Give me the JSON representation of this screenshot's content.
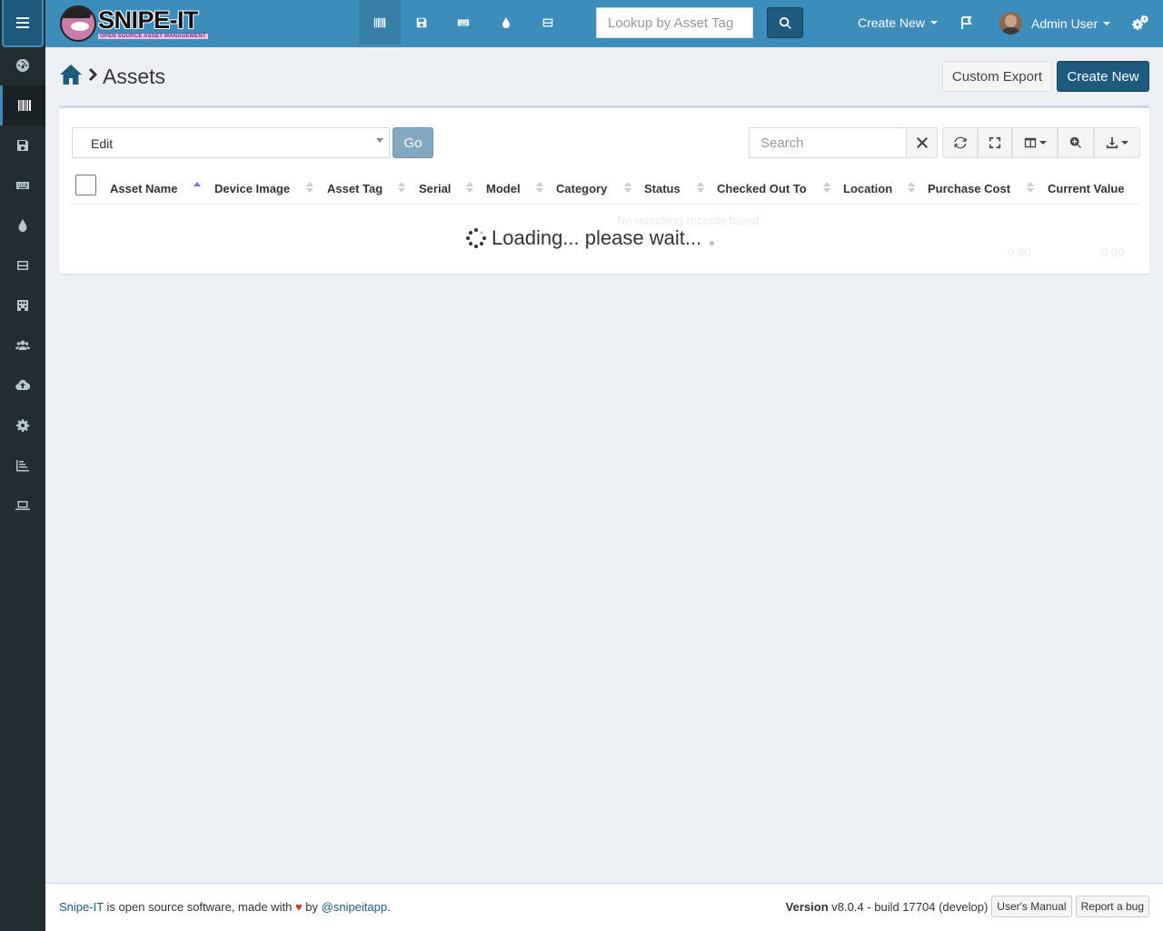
{
  "app": {
    "logo_title": "SNIPE-IT",
    "logo_subtitle": "OPEN SOURCE ASSET MANAGEMENT"
  },
  "header": {
    "lookup_placeholder": "Lookup by Asset Tag",
    "create_new": "Create New",
    "user_name": "Admin User",
    "nav_icons": [
      "barcode-icon",
      "floppy-icon",
      "keyboard-icon",
      "tint-icon",
      "hdd-icon"
    ]
  },
  "sidebar": {
    "items": [
      "dashboard-icon",
      "barcode-icon",
      "floppy-icon",
      "keyboard-icon",
      "tint-icon",
      "hdd-icon",
      "building-icon",
      "users-icon",
      "cloud-upload-icon",
      "gear-icon",
      "chart-icon",
      "laptop-icon"
    ],
    "active_index": 1
  },
  "page": {
    "title": "Assets",
    "custom_export": "Custom Export",
    "create_new": "Create New"
  },
  "table": {
    "bulk_action": "Edit",
    "go_label": "Go",
    "search_placeholder": "Search",
    "columns": [
      "Asset Name",
      "Device Image",
      "Asset Tag",
      "Serial",
      "Model",
      "Category",
      "Status",
      "Checked Out To",
      "Location",
      "Purchase Cost",
      "Current Value"
    ],
    "empty_text": "No matching records found",
    "total_purchase_cost": "0.00",
    "total_current_value": "0.00",
    "loading_text": "Loading... please wait..."
  },
  "footer": {
    "brand_link": "Snipe-IT",
    "text_1": "is open source software, made with",
    "text_2": "by",
    "twitter_link": "@snipeitapp",
    "period": ".",
    "version_label": "Version",
    "version_value": "v8.0.4 - build 17704 (develop)",
    "manual_button": "User's Manual",
    "bug_button": "Report a bug"
  }
}
